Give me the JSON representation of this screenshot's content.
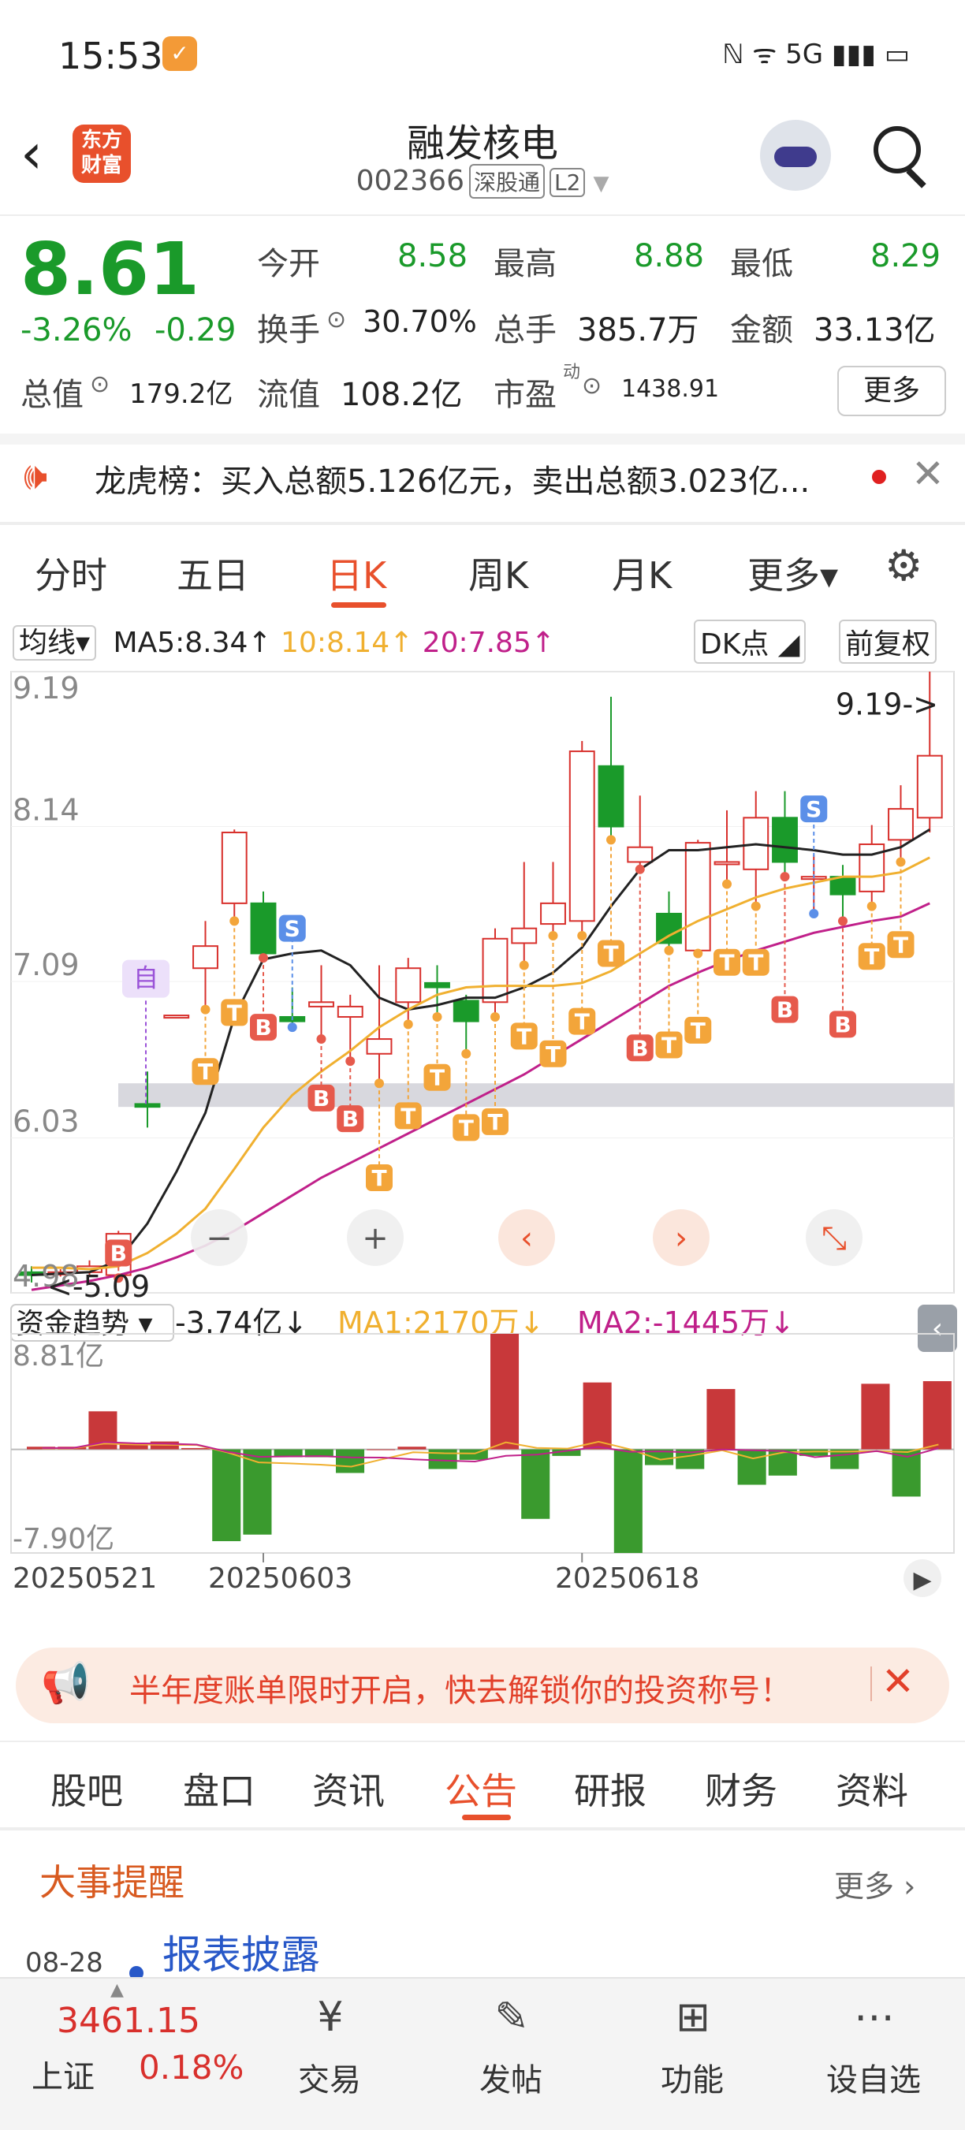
{
  "status_bar": {
    "time": "15:53",
    "icons": "ℕ ᯤ 5G ▮▮▮ ▭"
  },
  "header": {
    "logo_line1": "东方",
    "logo_line2": "财富",
    "name": "融发核电",
    "code": "002366",
    "tag1": "深股通",
    "tag2": "L2"
  },
  "quote": {
    "price": "8.61",
    "pct": "-3.26%",
    "change": "-0.29",
    "open_label": "今开",
    "open": "8.58",
    "high_label": "最高",
    "high": "8.88",
    "low_label": "最低",
    "low": "8.29",
    "turnover_label": "换手",
    "turnover": "30.70%",
    "volume_label": "总手",
    "volume": "385.7万",
    "amount_label": "金额",
    "amount": "33.13亿",
    "mcap_label": "总值",
    "mcap": "179.2亿",
    "float_label": "流值",
    "float": "108.2亿",
    "pe_label": "市盈",
    "pe_sup": "动",
    "pe": "1438.91",
    "more": "更多"
  },
  "lhb": {
    "text": "龙虎榜：买入总额5.126亿元，卖出总额3.023亿..."
  },
  "chart_tabs": [
    "分时",
    "五日",
    "日K",
    "周K",
    "月K",
    "更多▾"
  ],
  "chart_header": {
    "ind": "均线▾",
    "ma5": "MA5:8.34↑",
    "ma10": "10:8.14↑",
    "ma20": "20:7.85↑",
    "dk": "DK点 ◢",
    "fq": "前复权"
  },
  "colors": {
    "up": "#d8302c",
    "down": "#1a9a2a",
    "ma5": "#222222",
    "ma10": "#f0b030",
    "ma20": "#c0208a",
    "accent": "#e8502c"
  },
  "chart_data": [
    {
      "type": "candlestick",
      "y_ticks": [
        "9.19",
        "8.14",
        "7.09",
        "6.03",
        "4.98"
      ],
      "ylim": [
        4.98,
        9.19
      ],
      "high_marker": "9.19->",
      "low_marker": "<-5.09",
      "x_ticks": [
        "20250521",
        "20250603",
        "20250618"
      ],
      "candles": [
        [
          5.12,
          5.1,
          5.16,
          5.05
        ],
        [
          5.12,
          5.12,
          5.14,
          5.09
        ],
        [
          5.12,
          5.16,
          5.2,
          5.1
        ],
        [
          5.1,
          5.38,
          5.4,
          5.08
        ],
        [
          6.26,
          6.24,
          6.48,
          6.1
        ],
        [
          6.86,
          6.86,
          6.86,
          6.86
        ],
        [
          7.18,
          7.33,
          7.5,
          6.9
        ],
        [
          7.62,
          8.1,
          8.12,
          7.5
        ],
        [
          7.62,
          7.28,
          7.7,
          7.25
        ],
        [
          6.85,
          6.82,
          7.05,
          6.78
        ],
        [
          6.92,
          6.95,
          7.2,
          6.7
        ],
        [
          6.85,
          6.92,
          7.0,
          6.55
        ],
        [
          6.6,
          6.7,
          7.2,
          6.4
        ],
        [
          6.95,
          7.18,
          7.25,
          6.8
        ],
        [
          7.08,
          7.05,
          7.2,
          6.85
        ],
        [
          6.96,
          6.82,
          7.0,
          6.6
        ],
        [
          6.95,
          7.38,
          7.45,
          6.85
        ],
        [
          7.35,
          7.45,
          7.9,
          7.2
        ],
        [
          7.48,
          7.62,
          7.9,
          7.4
        ],
        [
          7.5,
          8.65,
          8.72,
          7.4
        ],
        [
          8.55,
          8.14,
          9.02,
          8.05
        ],
        [
          7.9,
          8.0,
          8.35,
          7.85
        ],
        [
          7.55,
          7.35,
          7.7,
          7.3
        ],
        [
          7.3,
          8.03,
          8.05,
          7.28
        ],
        [
          7.9,
          7.9,
          8.25,
          7.75
        ],
        [
          7.85,
          8.2,
          8.38,
          7.6
        ],
        [
          8.2,
          7.9,
          8.38,
          7.8
        ],
        [
          7.8,
          7.8,
          7.95,
          7.55
        ],
        [
          7.8,
          7.68,
          7.88,
          7.5
        ],
        [
          7.7,
          8.02,
          8.15,
          7.6
        ],
        [
          8.05,
          8.26,
          8.42,
          7.9
        ],
        [
          8.2,
          8.62,
          9.19,
          8.1
        ]
      ],
      "ma5": [
        5.1,
        5.11,
        5.12,
        5.2,
        5.45,
        5.8,
        6.2,
        6.85,
        7.24,
        7.28,
        7.3,
        7.2,
        6.98,
        6.9,
        6.93,
        6.98,
        6.98,
        7.05,
        7.15,
        7.32,
        7.6,
        7.85,
        7.98,
        7.98,
        8.0,
        8.02,
        8.0,
        7.98,
        7.95,
        7.95,
        8.0,
        8.12
      ],
      "ma10": [
        5.15,
        5.15,
        5.14,
        5.16,
        5.25,
        5.38,
        5.55,
        5.82,
        6.1,
        6.32,
        6.48,
        6.62,
        6.78,
        6.9,
        7.0,
        7.05,
        7.06,
        7.06,
        7.06,
        7.08,
        7.16,
        7.28,
        7.4,
        7.5,
        7.58,
        7.66,
        7.72,
        7.76,
        7.8,
        7.8,
        7.83,
        7.93
      ],
      "ma20": [
        5.0,
        5.03,
        5.06,
        5.1,
        5.15,
        5.22,
        5.3,
        5.4,
        5.52,
        5.64,
        5.76,
        5.86,
        5.96,
        6.06,
        6.16,
        6.26,
        6.36,
        6.46,
        6.58,
        6.7,
        6.82,
        6.94,
        7.06,
        7.15,
        7.23,
        7.3,
        7.36,
        7.42,
        7.46,
        7.5,
        7.53,
        7.62
      ],
      "signals": [
        {
          "i": 3,
          "t": "B",
          "y": 5.25
        },
        {
          "i": 6,
          "t": "T",
          "y": 6.48
        },
        {
          "i": 7,
          "t": "T",
          "y": 6.88
        },
        {
          "i": 8,
          "t": "B",
          "y": 6.78
        },
        {
          "i": 9,
          "t": "S",
          "y": 7.45
        },
        {
          "i": 10,
          "t": "B",
          "y": 6.3
        },
        {
          "i": 11,
          "t": "B",
          "y": 6.16
        },
        {
          "i": 12,
          "t": "T",
          "y": 5.76
        },
        {
          "i": 13,
          "t": "T",
          "y": 6.18
        },
        {
          "i": 14,
          "t": "T",
          "y": 6.44
        },
        {
          "i": 15,
          "t": "T",
          "y": 6.1
        },
        {
          "i": 16,
          "t": "T",
          "y": 6.14
        },
        {
          "i": 17,
          "t": "T",
          "y": 6.72
        },
        {
          "i": 18,
          "t": "T",
          "y": 6.6
        },
        {
          "i": 19,
          "t": "T",
          "y": 6.82
        },
        {
          "i": 20,
          "t": "T",
          "y": 7.28
        },
        {
          "i": 21,
          "t": "B",
          "y": 6.64
        },
        {
          "i": 22,
          "t": "T",
          "y": 6.66
        },
        {
          "i": 23,
          "t": "T",
          "y": 6.76
        },
        {
          "i": 24,
          "t": "T",
          "y": 7.22
        },
        {
          "i": 25,
          "t": "T",
          "y": 7.22
        },
        {
          "i": 26,
          "t": "B",
          "y": 6.9
        },
        {
          "i": 27,
          "t": "S",
          "y": 8.26
        },
        {
          "i": 28,
          "t": "B",
          "y": 6.8
        },
        {
          "i": 29,
          "t": "T",
          "y": 7.26
        },
        {
          "i": 30,
          "t": "T",
          "y": 7.34
        }
      ],
      "marker_text": "自"
    },
    {
      "type": "bar",
      "title": "资金趋势",
      "value": "-3.74亿↓",
      "ma1": "MA1:2170万↓",
      "ma2": "MA2:-1445万↓",
      "y_ticks": [
        "8.81亿",
        "-7.90亿"
      ],
      "ylim": [
        -7.9,
        8.81
      ],
      "values": [
        0.2,
        0.2,
        2.9,
        0.4,
        0.6,
        0.1,
        -7.0,
        -6.5,
        -0.6,
        -0.6,
        -1.8,
        0.0,
        0.2,
        -1.5,
        -0.8,
        8.81,
        -5.3,
        -0.5,
        5.1,
        -7.9,
        -1.2,
        -1.5,
        4.6,
        -2.7,
        -2.0,
        -0.5,
        -1.5,
        5.0,
        -3.6,
        5.2
      ]
    }
  ],
  "chart_controls": [
    "−",
    "+",
    "‹",
    "›",
    "⤡"
  ],
  "banner": {
    "text": "半年度账单限时开启，快去解锁你的投资称号！"
  },
  "news_tabs": [
    "股吧",
    "盘口",
    "资讯",
    "公告",
    "研报",
    "财务",
    "资料"
  ],
  "events": {
    "title": "大事提醒",
    "more": "更多 ›",
    "date": "08-28",
    "item": "报表披露"
  },
  "bottom": {
    "index_value": "3461.15",
    "index_name": "上证",
    "index_pct": "0.18%",
    "items": [
      {
        "label": "交易",
        "icon": "¥"
      },
      {
        "label": "发帖",
        "icon": "✎"
      },
      {
        "label": "功能",
        "icon": "⊞"
      },
      {
        "label": "设自选",
        "icon": "⋯"
      }
    ]
  }
}
